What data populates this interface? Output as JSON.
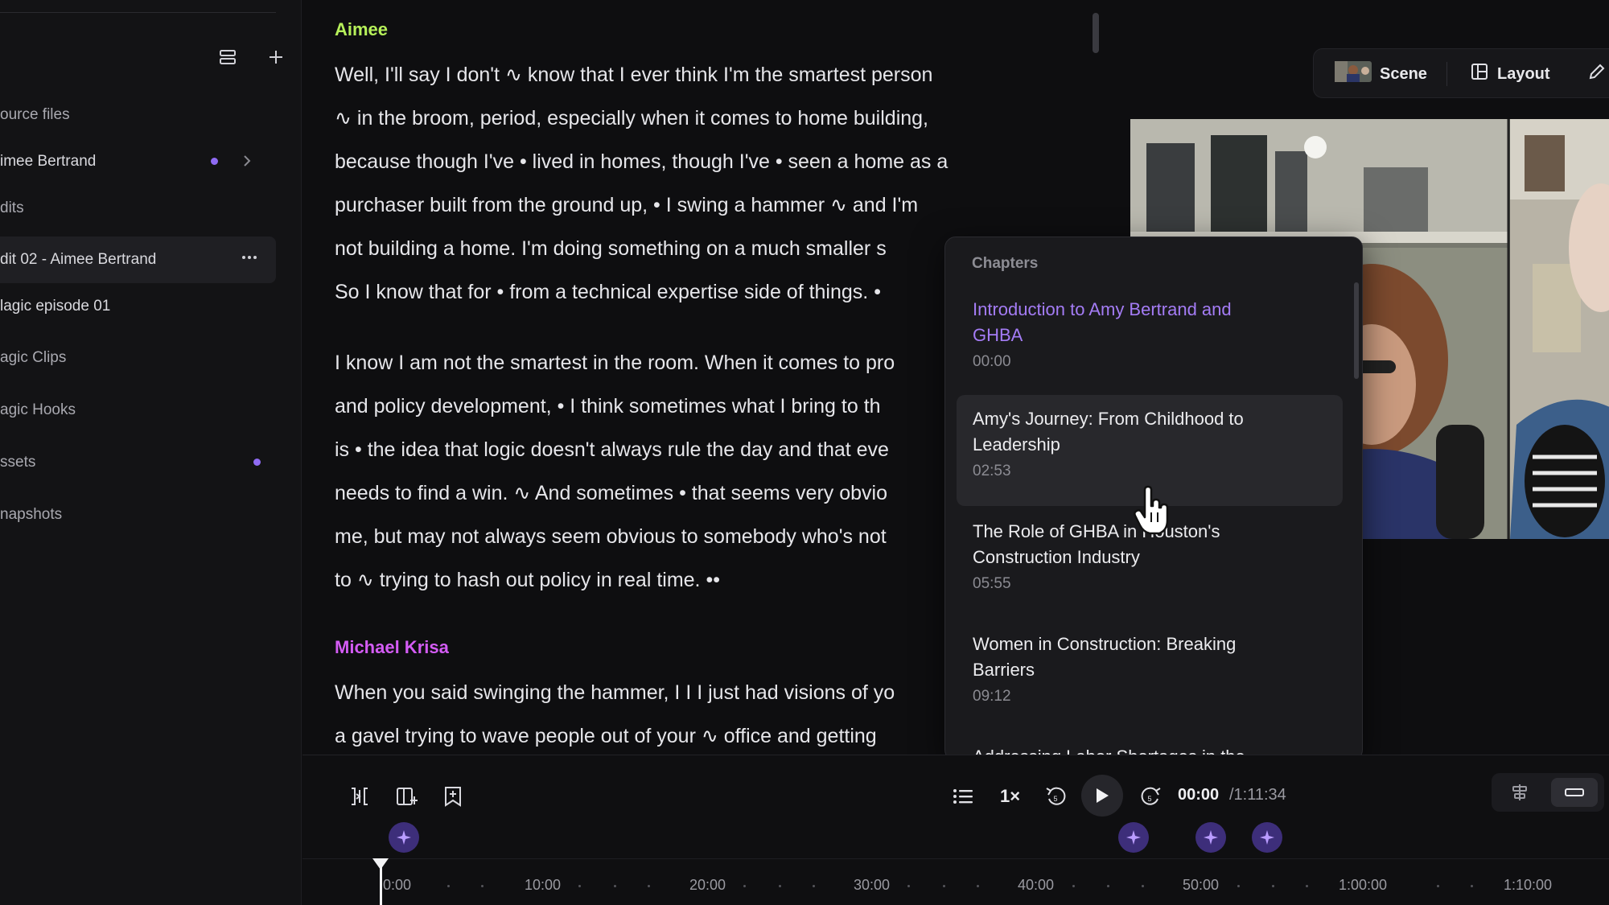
{
  "sidebar": {
    "items": [
      {
        "label": "ource files",
        "type": "section"
      },
      {
        "label": "imee Bertrand",
        "type": "item",
        "dot": true,
        "chevron": true
      },
      {
        "label": "dits",
        "type": "section"
      },
      {
        "label": "dit 02 - Aimee Bertrand",
        "type": "item",
        "active": true,
        "more": true
      },
      {
        "label": "lagic episode 01",
        "type": "item"
      },
      {
        "label": "agic Clips",
        "type": "section"
      },
      {
        "label": "agic Hooks",
        "type": "section"
      },
      {
        "label": "ssets",
        "type": "section",
        "dot": true
      },
      {
        "label": "napshots",
        "type": "section"
      }
    ],
    "more_label": "···"
  },
  "transcript": {
    "speaker1": "Aimee",
    "para1": [
      "Well, I'll say I don't ∿ know that I ever think I'm the smartest person",
      "∿ in the broom, period, especially when it comes to home building,",
      "because though I've • lived in homes, though I've • seen a home as a",
      "purchaser  built from the ground up, • I swing a hammer ∿ and I'm",
      "not  building a home. I'm doing something on a much smaller s",
      "So I know that for • from a technical expertise side of things. •"
    ],
    "para2": [
      "I know I am not the smartest in the room. When it comes to pro",
      "and policy development, • I think sometimes what I bring to th",
      "is • the idea that logic doesn't always rule the day and that eve",
      "needs to find a win. ∿ And sometimes • that seems very obvio",
      "me, but may not always seem obvious to somebody who's not",
      "to ∿ trying to hash out policy in real time. ••"
    ],
    "speaker2": "Michael Krisa",
    "para3": [
      "When you said swinging the hammer, I I I just had visions of yo",
      "a gavel trying to wave people out of your ∿ office and getting"
    ]
  },
  "preview": {
    "scene_label": "Scene",
    "layout_label": "Layout"
  },
  "chapters": {
    "title": "Chapters",
    "items": [
      {
        "title": "Introduction to Amy Bertrand and GHBA",
        "lines": [
          "Introduction to Amy Bertrand and",
          "GHBA"
        ],
        "time": "00:00",
        "current": true
      },
      {
        "title": "Amy's Journey: From Childhood to Leadership",
        "lines": [
          "Amy's Journey: From Childhood to",
          "Leadership"
        ],
        "time": "02:53",
        "hover": true
      },
      {
        "title": "The Role of GHBA in Houston's Construction Industry",
        "lines": [
          "The Role of GHBA in Houston's",
          "Construction Industry"
        ],
        "time": "05:55"
      },
      {
        "title": "Women in Construction: Breaking Barriers",
        "lines": [
          "Women in Construction: Breaking",
          "Barriers"
        ],
        "time": "09:12"
      },
      {
        "title": "Addressing Labor Shortages in the",
        "lines": [
          "Addressing Labor Shortages in the"
        ],
        "time": ""
      }
    ]
  },
  "player": {
    "speed": "1×",
    "current_time": "00:00",
    "total_time": "/1:11:34",
    "timeline_labels": [
      "0:00",
      "10:00",
      "20:00",
      "30:00",
      "40:00",
      "50:00",
      "1:00:00",
      "1:10:00"
    ]
  },
  "colors": {
    "accent": "#8f6bf3",
    "speaker_aimee": "#b6f05a",
    "speaker_michael": "#d45cf5",
    "chapter_current": "#a47cf5"
  }
}
